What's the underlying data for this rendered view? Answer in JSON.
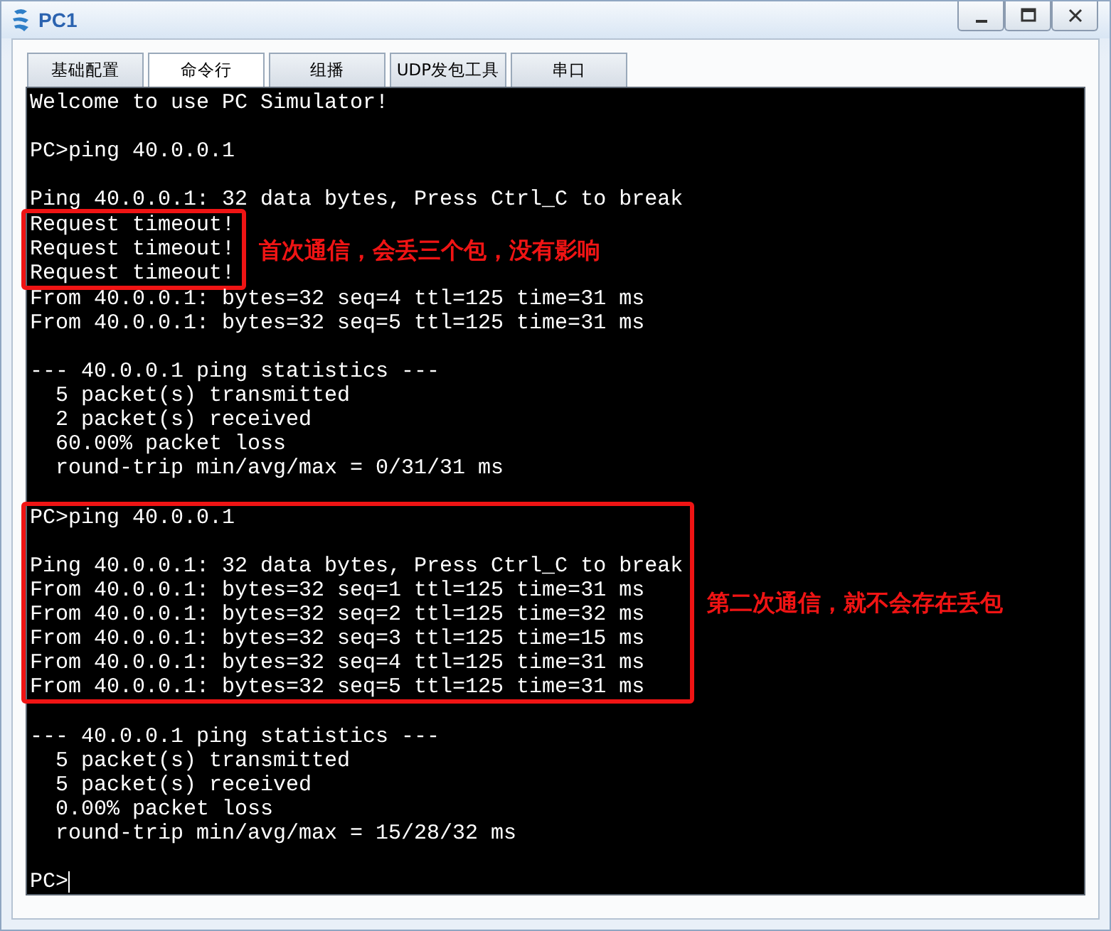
{
  "window": {
    "title": "PC1"
  },
  "tabs": [
    {
      "label": "基础配置",
      "selected": false
    },
    {
      "label": "命令行",
      "selected": true
    },
    {
      "label": "组播",
      "selected": false
    },
    {
      "label": "UDP发包工具",
      "selected": false
    },
    {
      "label": "串口",
      "selected": false
    }
  ],
  "terminal": {
    "blocks": [
      {
        "kind": "text",
        "paragraphs": [
          [
            "Welcome to use PC Simulator!"
          ],
          [
            "PC>ping 40.0.0.1"
          ],
          [
            "Ping 40.0.0.1: 32 data bytes, Press Ctrl_C to break"
          ]
        ]
      },
      {
        "kind": "marked",
        "note": "首次通信，会丢三个包，没有影响",
        "paragraphs": [
          [
            "Request timeout!",
            "Request timeout!",
            "Request timeout!"
          ]
        ]
      },
      {
        "kind": "text",
        "paragraphs": [
          [
            "From 40.0.0.1: bytes=32 seq=4 ttl=125 time=31 ms",
            "From 40.0.0.1: bytes=32 seq=5 ttl=125 time=31 ms"
          ],
          [
            "--- 40.0.0.1 ping statistics ---",
            "  5 packet(s) transmitted",
            "  2 packet(s) received",
            "  60.00% packet loss",
            "  round-trip min/avg/max = 0/31/31 ms"
          ]
        ]
      },
      {
        "kind": "blank"
      },
      {
        "kind": "marked",
        "note": "第二次通信，就不会存在丢包",
        "paragraphs": [
          [
            "PC>ping 40.0.0.1"
          ],
          [
            "Ping 40.0.0.1: 32 data bytes, Press Ctrl_C to break",
            "From 40.0.0.1: bytes=32 seq=1 ttl=125 time=31 ms",
            "From 40.0.0.1: bytes=32 seq=2 ttl=125 time=32 ms",
            "From 40.0.0.1: bytes=32 seq=3 ttl=125 time=15 ms",
            "From 40.0.0.1: bytes=32 seq=4 ttl=125 time=31 ms",
            "From 40.0.0.1: bytes=32 seq=5 ttl=125 time=31 ms"
          ]
        ]
      },
      {
        "kind": "blank"
      },
      {
        "kind": "text",
        "paragraphs": [
          [
            "--- 40.0.0.1 ping statistics ---",
            "  5 packet(s) transmitted",
            "  5 packet(s) received",
            "  0.00% packet loss",
            "  round-trip min/avg/max = 15/28/32 ms"
          ]
        ]
      }
    ],
    "prompt": "PC>"
  }
}
